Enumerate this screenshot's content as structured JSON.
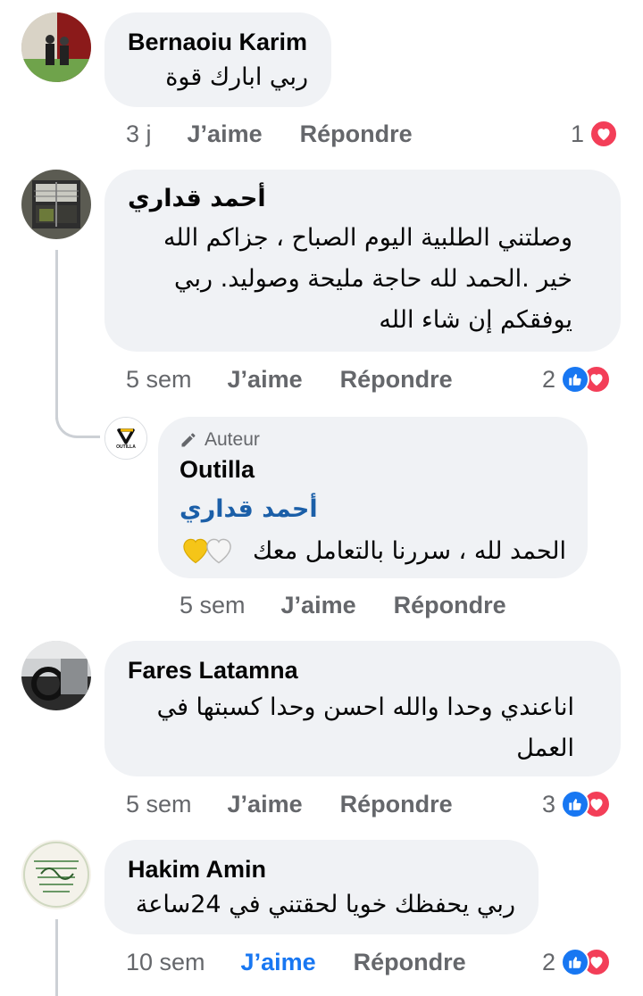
{
  "comments": [
    {
      "author": "Bernaoiu Karim",
      "text": "ربي ابارك قوة",
      "time": "3 j",
      "like_label": "J’aime",
      "reply_label": "Répondre",
      "reaction_count": "1",
      "reactions": [
        "love"
      ]
    },
    {
      "author": "أحمد قداري",
      "text": "وصلتني الطلبية اليوم الصباح ، جزاكم الله خير .الحمد لله حاجة مليحة وصوليد. ربي يوفقكم إن شاء الله",
      "time": "5 sem",
      "like_label": "J’aime",
      "reply_label": "Répondre",
      "reaction_count": "2",
      "reactions": [
        "like",
        "love"
      ]
    },
    {
      "badge": "Auteur",
      "author": "Outilla",
      "mention": "أحمد قداري",
      "text": "الحمد لله ، سررنا بالتعامل معك",
      "emojis": [
        "yellow-heart",
        "white-heart"
      ],
      "avatar_logo_text": "OUTILLA",
      "time": "5 sem",
      "like_label": "J’aime",
      "reply_label": "Répondre"
    },
    {
      "author": "Fares Latamna",
      "text": "اناعندي وحدا والله احسن وحدا كسبتها في العمل",
      "time": "5 sem",
      "like_label": "J’aime",
      "reply_label": "Répondre",
      "reaction_count": "3",
      "reactions": [
        "like",
        "love"
      ]
    },
    {
      "author": "Hakim Amin",
      "text": "ربي يحفظك خويا لحقتني في 24ساعة",
      "time": "10 sem",
      "like_label": "J’aime",
      "like_active": true,
      "reply_label": "Répondre",
      "reaction_count": "2",
      "reactions": [
        "like",
        "love"
      ]
    }
  ],
  "colors": {
    "bubble": "#f0f2f5",
    "meta": "#65676b",
    "like_active": "#1877f2",
    "love": "#f33e58",
    "mention": "#1b5fa8"
  }
}
